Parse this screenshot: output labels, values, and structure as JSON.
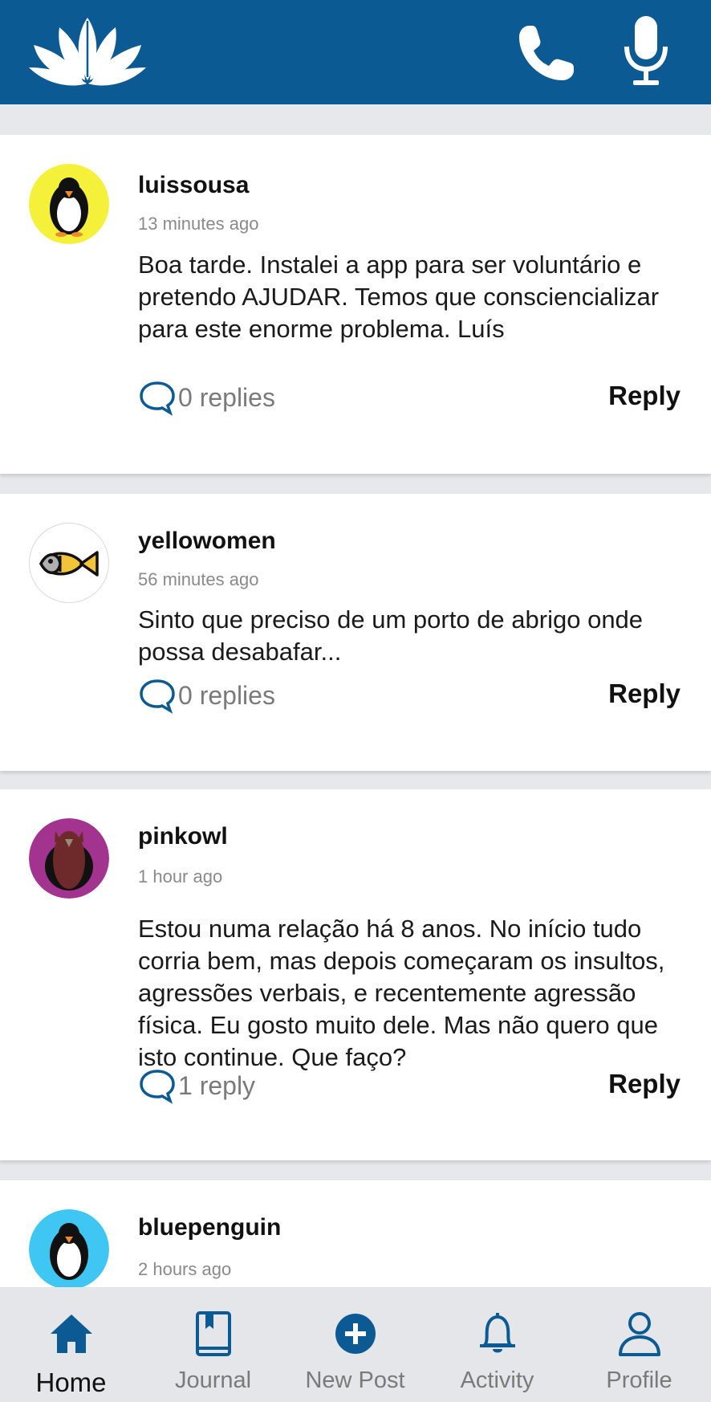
{
  "header": {
    "logo_icon": "lotus-icon",
    "call_icon": "phone-icon",
    "voice_icon": "microphone-icon",
    "background": "#0c5a93"
  },
  "posts": [
    {
      "username": "luissousa",
      "time": "13 minutes ago",
      "text": "Boa tarde. Instalei a app para ser voluntário e pretendo AJUDAR. Temos que consciencializar para este enorme problema. Luís",
      "replies": "0 replies",
      "reply_label": "Reply",
      "avatar_icon": "penguin-icon",
      "avatar_color": "#f5f03a"
    },
    {
      "username": "yellowomen",
      "time": "56 minutes ago",
      "text": "Sinto que preciso de um porto de abrigo onde possa desabafar...",
      "replies": "0 replies",
      "reply_label": "Reply",
      "avatar_icon": "fish-icon",
      "avatar_color": "#ffffff"
    },
    {
      "username": "pinkowl",
      "time": "1 hour ago",
      "text": "Estou numa relação há 8 anos.  No início tudo corria bem, mas depois começaram os insultos, agressões verbais, e recentemente agressão física. Eu gosto muito dele. Mas não quero que isto continue. Que faço?",
      "replies": "1 reply",
      "reply_label": "Reply",
      "avatar_icon": "owl-icon",
      "avatar_color": "#a2338f"
    },
    {
      "username": "bluepenguin",
      "time": "2 hours ago",
      "avatar_icon": "penguin-icon",
      "avatar_color": "#3fc6f2"
    }
  ],
  "tabs": [
    {
      "label": "Home",
      "icon": "home-icon",
      "active": true
    },
    {
      "label": "Journal",
      "icon": "journal-icon",
      "active": false
    },
    {
      "label": "New Post",
      "icon": "plus-circle-icon",
      "active": false
    },
    {
      "label": "Activity",
      "icon": "bell-icon",
      "active": false
    },
    {
      "label": "Profile",
      "icon": "user-icon",
      "active": false
    }
  ],
  "colors": {
    "accent": "#0c5a93",
    "background": "#e6e8eb",
    "card": "#ffffff",
    "tabbar": "#e4e6e9"
  }
}
